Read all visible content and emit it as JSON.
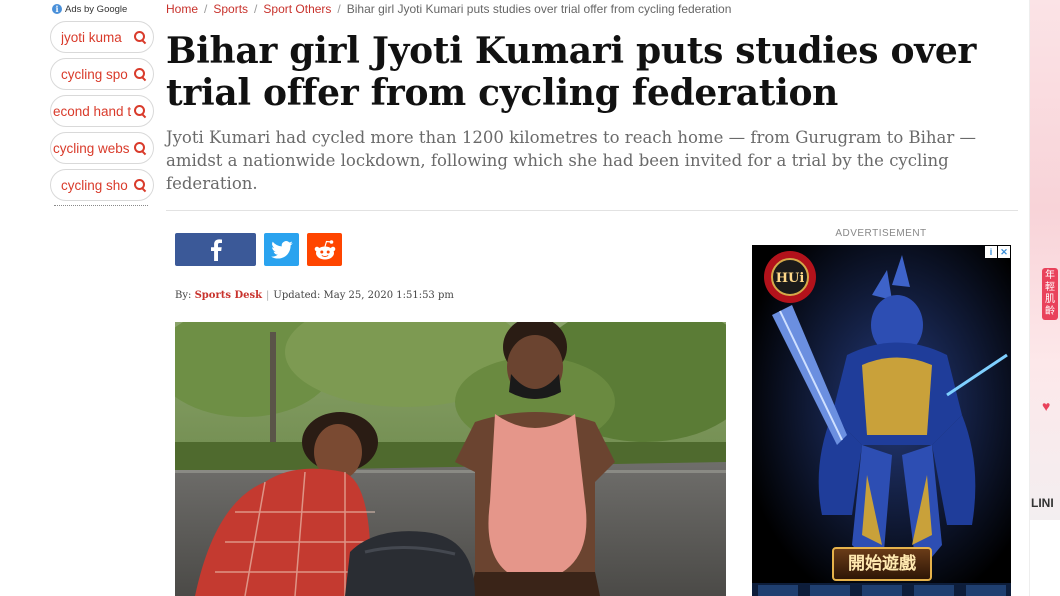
{
  "ads_sidebar": {
    "ads_by": "Ads by Google",
    "items": [
      {
        "label": "jyoti kuma"
      },
      {
        "label": "cycling spo"
      },
      {
        "label": "econd hand t"
      },
      {
        "label": "cycling webs"
      },
      {
        "label": "cycling sho"
      }
    ]
  },
  "breadcrumb": {
    "home": "Home",
    "sports": "Sports",
    "sport_others": "Sport Others",
    "current": "Bihar girl Jyoti Kumari puts studies over trial offer from cycling federation"
  },
  "article": {
    "title": "Bihar girl Jyoti Kumari puts studies over trial offer from cycling federation",
    "summary": "Jyoti Kumari had cycled more than 1200 kilometres to reach home — from Gurugram to Bihar — amidst a nationwide lockdown, following which she had been invited for a trial by the cycling federation.",
    "byline_prefix": "By:",
    "author": "Sports Desk",
    "updated": "Updated: May 25, 2020 1:51:53 pm"
  },
  "share": {
    "facebook_icon": "facebook-icon",
    "twitter_icon": "twitter-icon",
    "reddit_icon": "reddit-icon"
  },
  "advertisement": {
    "label": "ADVERTISEMENT",
    "cta": "開始遊戲",
    "logo": "HUi",
    "info_glyph": "i",
    "close_glyph": "✕"
  },
  "edge_ad": {
    "vertical_text": "年輕肌齡",
    "brand": "LINI"
  },
  "colors": {
    "accent": "#c8322c",
    "facebook": "#3b5998",
    "twitter": "#2aa3ef",
    "reddit": "#ff4500"
  }
}
